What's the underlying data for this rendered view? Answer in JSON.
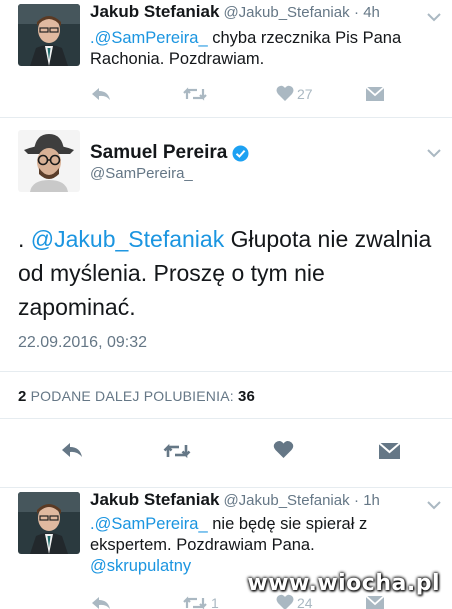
{
  "tweets": [
    {
      "name": "Jakub Stefaniak",
      "handle": "@Jakub_Stefaniak",
      "time": "· 4h",
      "text_mention": ".@SamPereira_",
      "text_rest_line1": " chyba rzecznika Pis Pana",
      "text_line2": "Rachonia. Pozdrawiam.",
      "likes": "27",
      "retweets": ""
    },
    {
      "name": "Jakub Stefaniak",
      "handle": "@Jakub_Stefaniak",
      "time": "· 1h",
      "text_mention": ".@SamPereira_",
      "text_rest_line1": " nie będę sie spierał z",
      "text_line2": "ekspertem. Pozdrawiam Pana.",
      "text_line3": "@skrupulatny",
      "retweets": "1",
      "likes": "24"
    }
  ],
  "main_tweet": {
    "name": "Samuel Pereira",
    "handle": "@SamPereira_",
    "text_prefix": ". ",
    "text_mention": "@Jakub_Stefaniak",
    "text_rest": " Głupota nie zwalnia od myślenia. Proszę o tym nie zapominać.",
    "date": "22.09.2016, 09:32",
    "retweet_count": "2",
    "retweet_label": " PODANE DALEJ ",
    "likes_label": " POLUBIENIA: ",
    "likes_count": "36"
  },
  "watermark": "www.wiocha.pl",
  "colors": {
    "link": "#1b95e0",
    "muted": "#657786",
    "icon": "#aab8c2",
    "icon_main": "#657786",
    "verified": "#1da1f2"
  },
  "icons": [
    "reply-icon",
    "retweet-icon",
    "heart-icon",
    "message-icon",
    "chevron-down-icon",
    "verified-badge-icon"
  ]
}
